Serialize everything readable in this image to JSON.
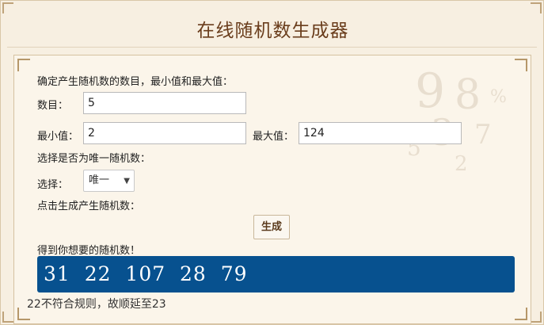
{
  "header": {
    "title": "在线随机数生成器"
  },
  "form": {
    "intro_label": "确定产生随机数的数目，最小值和最大值：",
    "count_label": "数目：",
    "count_value": "5",
    "min_label": "最小值：",
    "min_value": "2",
    "max_label": "最大值：",
    "max_value": "124",
    "unique_question": "选择是否为唯一随机数：",
    "choice_label": "选择：",
    "choice_selected": "唯一",
    "generate_prompt": "点击生成产生随机数：",
    "generate_button": "生成",
    "result_label": "得到你想要的随机数！",
    "result_values": "31  22  107  28  79",
    "note": "22不符合规则，故顺延至23"
  },
  "colors": {
    "title": "#6a3d1c",
    "result_bg": "#07518f",
    "page_bg": "#f7efe1"
  },
  "icons": {
    "select_caret": "triangle-down-icon"
  }
}
